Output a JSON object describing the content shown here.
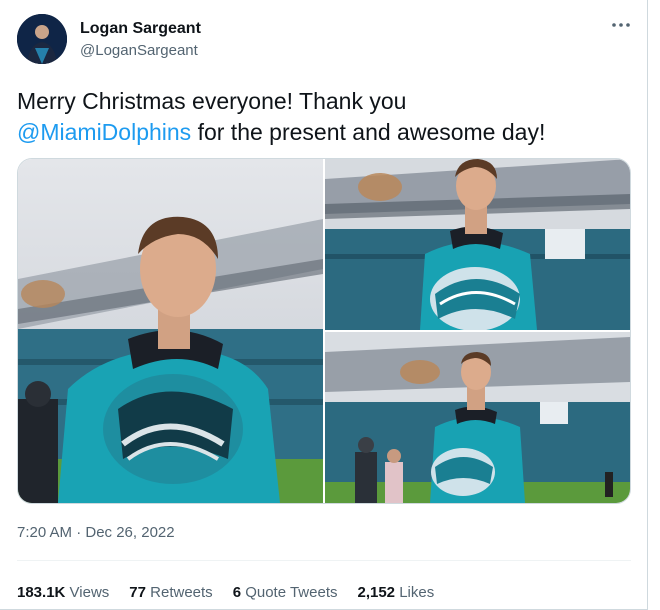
{
  "user": {
    "name": "Logan Sargeant",
    "handle": "@LoganSargeant"
  },
  "tweet": {
    "text_before": "Merry Christmas everyone! Thank you",
    "mention": "@MiamiDolphins",
    "text_after": " for the present and awesome day!",
    "timestamp": "7:20 AM · Dec 26, 2022"
  },
  "stats": {
    "views_count": "183.1K",
    "views_label": "Views",
    "retweets_count": "77",
    "retweets_label": "Retweets",
    "quotes_count": "6",
    "quotes_label": "Quote Tweets",
    "likes_count": "2,152",
    "likes_label": "Likes"
  },
  "colors": {
    "link": "#1d9bf0",
    "secondary_text": "#536471",
    "dolphins_aqua": "#1fa3b5"
  },
  "icons": {
    "more": "more-dots-icon"
  }
}
